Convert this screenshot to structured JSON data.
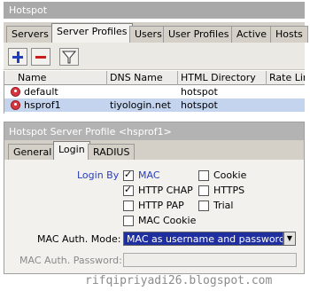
{
  "window": {
    "title": "Hotspot"
  },
  "tabs": [
    "Servers",
    "Server Profiles",
    "Users",
    "User Profiles",
    "Active",
    "Hosts"
  ],
  "active_tab": "Server Profiles",
  "toolbar": {
    "add_icon": "plus-icon",
    "remove_icon": "minus-icon",
    "filter_icon": "filter-icon"
  },
  "table": {
    "columns": [
      "Name",
      "DNS Name",
      "HTML Directory",
      "Rate Lin"
    ],
    "rows": [
      {
        "name": "default",
        "dns_name": "",
        "html_directory": "hotspot",
        "rate_limit": ""
      },
      {
        "name": "hsprof1",
        "dns_name": "tiyologin.net",
        "html_directory": "hotspot",
        "rate_limit": ""
      }
    ]
  },
  "dialog": {
    "title": "Hotspot Server Profile <hsprof1>",
    "tabs": [
      "General",
      "Login",
      "RADIUS"
    ],
    "active_tab": "Login",
    "login_by_label": "Login By",
    "options": [
      {
        "label": "MAC",
        "checked": true
      },
      {
        "label": "HTTP CHAP",
        "checked": true
      },
      {
        "label": "HTTP PAP",
        "checked": false
      },
      {
        "label": "MAC Cookie",
        "checked": false
      },
      {
        "label": "Cookie",
        "checked": false
      },
      {
        "label": "HTTPS",
        "checked": false
      },
      {
        "label": "Trial",
        "checked": false
      }
    ],
    "mac_auth_mode_label": "MAC Auth. Mode:",
    "mac_auth_mode_value": "MAC as username and password",
    "mac_auth_password_label": "MAC Auth. Password:",
    "mac_auth_password_value": ""
  },
  "watermark": "rifqipriyadi26.blogspot.com",
  "colors": {
    "add": "#1f3fbf",
    "remove": "#c81e1e",
    "selected_row": "#c4d4ee",
    "select_bg": "#1f2f9f"
  }
}
